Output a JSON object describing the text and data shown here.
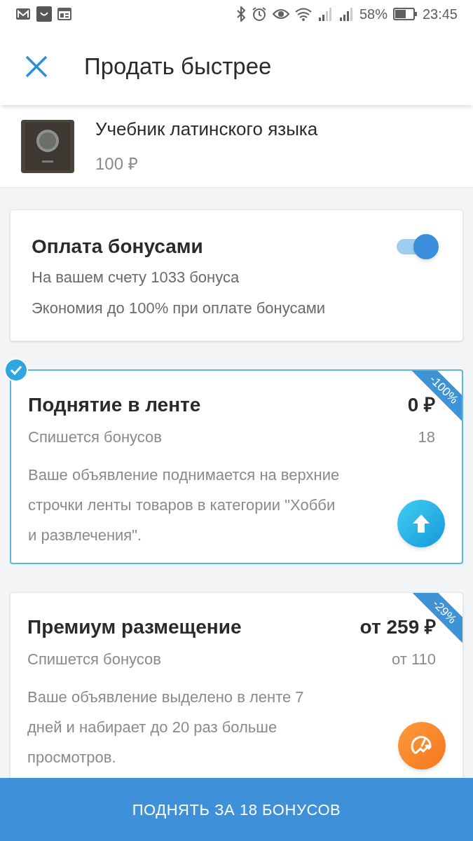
{
  "status_bar": {
    "battery": "58%",
    "time": "23:45"
  },
  "header": {
    "title": "Продать быстрее"
  },
  "product": {
    "title": "Учебник латинского языка",
    "price": "100 ₽"
  },
  "bonus_card": {
    "title": "Оплата бонусами",
    "on": true,
    "lines": [
      "На вашем счету 1033 бонуса",
      "Экономия до 100% при оплате бонусами"
    ]
  },
  "offers": [
    {
      "kind": "lift",
      "selected": true,
      "title": "Поднятие в ленте",
      "price": "0 ₽",
      "bonus_label": "Спишется бонусов",
      "bonus_value": "18",
      "description": "Ваше объявление поднимается на верхние строчки ленты товаров в категории \"Хобби и развлечения\".",
      "discount": "-100%"
    },
    {
      "kind": "premium",
      "selected": false,
      "title": "Премиум размещение",
      "price": "от 259 ₽",
      "bonus_label": "Спишется бонусов",
      "bonus_value": "от 110",
      "description": "Ваше объявление выделено в ленте 7 дней и набирает до 20 раз больше просмотров.",
      "discount": "-29%"
    }
  ],
  "action_button": {
    "label": "ПОДНЯТЬ ЗА 18 БОНУСОВ"
  }
}
